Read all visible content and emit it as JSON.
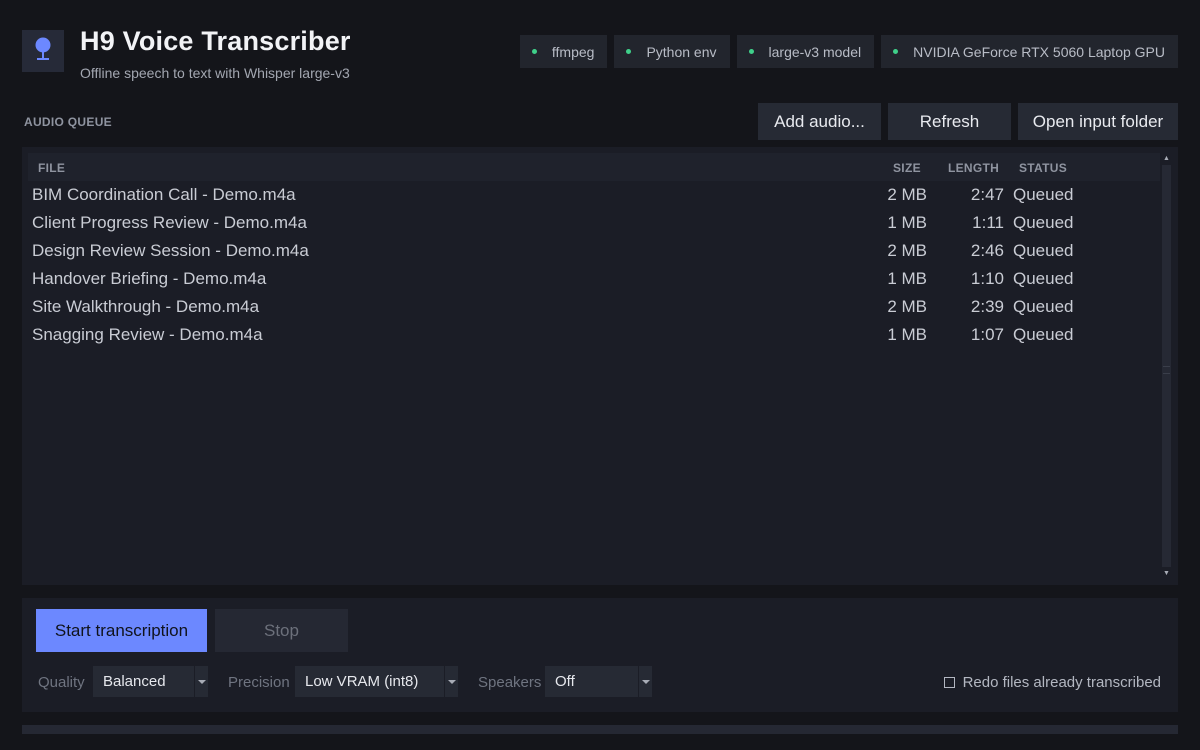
{
  "header": {
    "title": "H9 Voice Transcriber",
    "subtitle": "Offline speech to text with Whisper large-v3",
    "logo_icon": "microphone-icon",
    "accent_color": "#6c88ff"
  },
  "status_chips": [
    {
      "label": "ffmpeg",
      "status": "ok"
    },
    {
      "label": "Python env",
      "status": "ok"
    },
    {
      "label": "large-v3 model",
      "status": "ok"
    },
    {
      "label": "NVIDIA GeForce RTX 5060 Laptop GPU",
      "status": "ok"
    }
  ],
  "status_ok_color": "#3fd08a",
  "queue": {
    "section_label": "AUDIO QUEUE",
    "buttons": {
      "add": "Add audio...",
      "refresh": "Refresh",
      "open_folder": "Open input folder"
    },
    "columns": {
      "file": "FILE",
      "size": "SIZE",
      "length": "LENGTH",
      "status": "STATUS"
    },
    "rows": [
      {
        "file": "BIM Coordination Call - Demo.m4a",
        "size": "2 MB",
        "length": "2:47",
        "status": "Queued"
      },
      {
        "file": "Client Progress Review - Demo.m4a",
        "size": "1 MB",
        "length": "1:11",
        "status": "Queued"
      },
      {
        "file": "Design Review Session - Demo.m4a",
        "size": "2 MB",
        "length": "2:46",
        "status": "Queued"
      },
      {
        "file": "Handover Briefing - Demo.m4a",
        "size": "1 MB",
        "length": "1:10",
        "status": "Queued"
      },
      {
        "file": "Site Walkthrough - Demo.m4a",
        "size": "2 MB",
        "length": "2:39",
        "status": "Queued"
      },
      {
        "file": "Snagging Review - Demo.m4a",
        "size": "1 MB",
        "length": "1:07",
        "status": "Queued"
      }
    ]
  },
  "controls": {
    "start": "Start transcription",
    "stop": "Stop",
    "quality": {
      "label": "Quality",
      "value": "Balanced"
    },
    "precision": {
      "label": "Precision",
      "value": "Low VRAM (int8)"
    },
    "speakers": {
      "label": "Speakers",
      "value": "Off"
    },
    "redo_label": "Redo files already transcribed",
    "redo_checked": false
  }
}
